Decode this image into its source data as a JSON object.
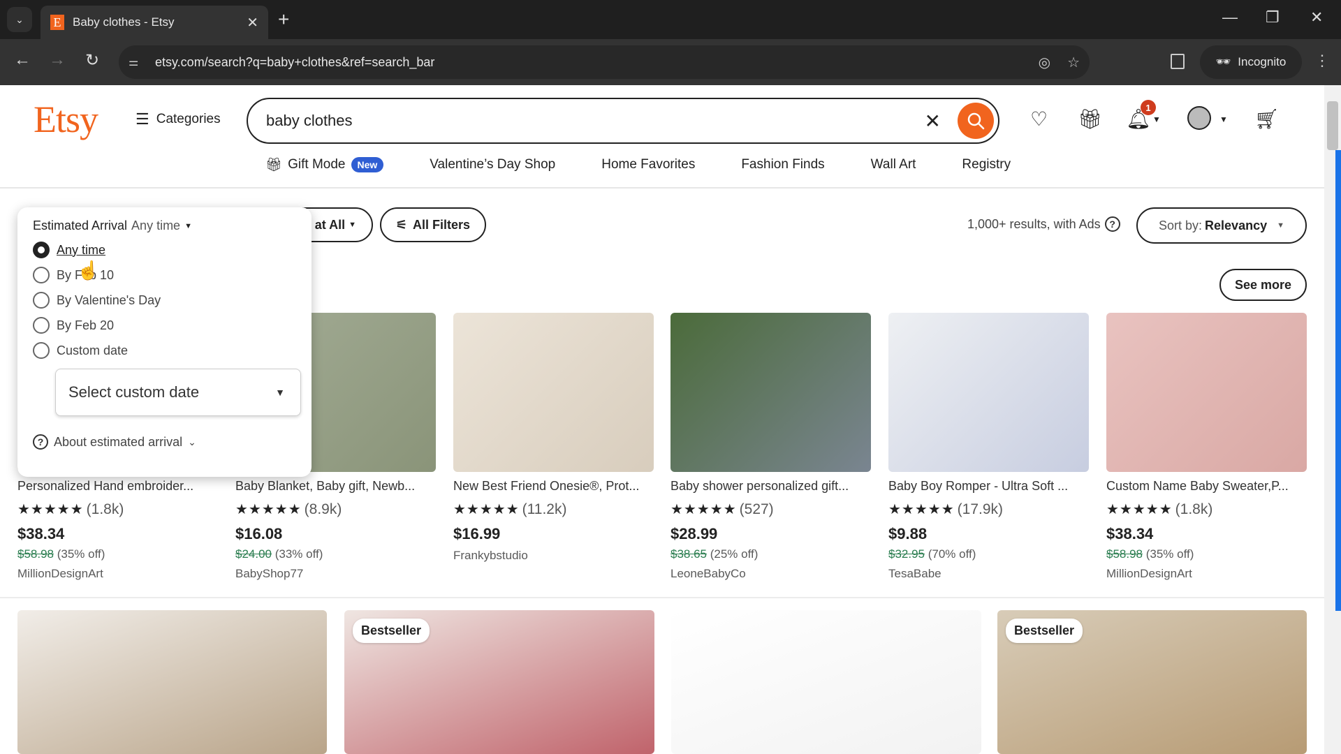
{
  "browser": {
    "tab_title": "Baby clothes - Etsy",
    "tab_favicon": "E",
    "url": "etsy.com/search?q=baby+clothes&ref=search_bar",
    "incognito_label": "Incognito",
    "icons": {
      "tab_list": "chevron-down-icon",
      "back": "arrow-left-icon",
      "forward": "arrow-right-icon",
      "reload": "reload-icon",
      "site_info": "tune-icon",
      "tracking": "eye-off-icon",
      "bookmark": "star-icon"
    }
  },
  "header": {
    "logo": "Etsy",
    "categories_label": "Categories",
    "search_value": "baby clothes",
    "notification_count": "1",
    "nav": [
      {
        "label": "Gift Mode",
        "badge": "New"
      },
      {
        "label": "Valentine’s Day Shop"
      },
      {
        "label": "Home Favorites"
      },
      {
        "label": "Fashion Finds"
      },
      {
        "label": "Wall Art"
      },
      {
        "label": "Registry"
      }
    ]
  },
  "filters": {
    "partial_chip_label": "at All",
    "all_filters_label": "All Filters",
    "results_text": "1,000+ results, with Ads",
    "sort_prefix": "Sort by:",
    "sort_value": "Relevancy",
    "see_more_label": "See more"
  },
  "estimated_arrival": {
    "title": "Estimated Arrival",
    "current": "Any time",
    "options": [
      {
        "label": "Any time",
        "selected": true
      },
      {
        "label": "By Feb 10",
        "selected": false
      },
      {
        "label": "By Valentine's Day",
        "selected": false
      },
      {
        "label": "By Feb 20",
        "selected": false
      },
      {
        "label": "Custom date",
        "selected": false
      }
    ],
    "custom_date_placeholder": "Select custom date",
    "about_label": "About estimated arrival"
  },
  "products": [
    {
      "title": "Personalized Hand embroider...",
      "reviews": "(1.8k)",
      "price": "$38.34",
      "original_price": "$58.98",
      "discount": "(35% off)",
      "shop": "MillionDesignArt",
      "colors": [
        "#c9b9a3",
        "#a9a08f"
      ]
    },
    {
      "title": "Baby Blanket, Baby gift, Newb...",
      "reviews": "(8.9k)",
      "price": "$16.08",
      "original_price": "$24.00",
      "discount": "(33% off)",
      "shop": "BabyShop77",
      "colors": [
        "#a3ac95",
        "#8a9479"
      ]
    },
    {
      "title": "New Best Friend Onesie®, Prot...",
      "reviews": "(11.2k)",
      "price": "$16.99",
      "original_price": "",
      "discount": "",
      "shop": "Frankybstudio",
      "colors": [
        "#ece4d8",
        "#d8cdbd"
      ]
    },
    {
      "title": "Baby shower personalized gift...",
      "reviews": "(527)",
      "price": "$28.99",
      "original_price": "$38.65",
      "discount": "(25% off)",
      "shop": "LeoneBabyCo",
      "colors": [
        "#4b6b3a",
        "#7a8591"
      ]
    },
    {
      "title": "Baby Boy Romper - Ultra Soft ...",
      "reviews": "(17.9k)",
      "price": "$9.88",
      "original_price": "$32.95",
      "discount": "(70% off)",
      "shop": "TesaBabe",
      "colors": [
        "#eef0f3",
        "#c7cde0"
      ]
    },
    {
      "title": "Custom Name Baby Sweater,P...",
      "reviews": "(1.8k)",
      "price": "$38.34",
      "original_price": "$58.98",
      "discount": "(35% off)",
      "shop": "MillionDesignArt",
      "colors": [
        "#e9c3c0",
        "#d9a8a4"
      ]
    }
  ],
  "products_row2": [
    {
      "badge": "",
      "colors": [
        "#f1ede8",
        "#b9a489"
      ]
    },
    {
      "badge": "Bestseller",
      "colors": [
        "#efe6e2",
        "#c0636b"
      ]
    },
    {
      "badge": "",
      "colors": [
        "#ffffff",
        "#f2f2f2"
      ]
    },
    {
      "badge": "Bestseller",
      "colors": [
        "#d8ccb8",
        "#b79b74"
      ]
    }
  ],
  "rating_stars": "★★★★★",
  "brand_color": "#f1641e"
}
